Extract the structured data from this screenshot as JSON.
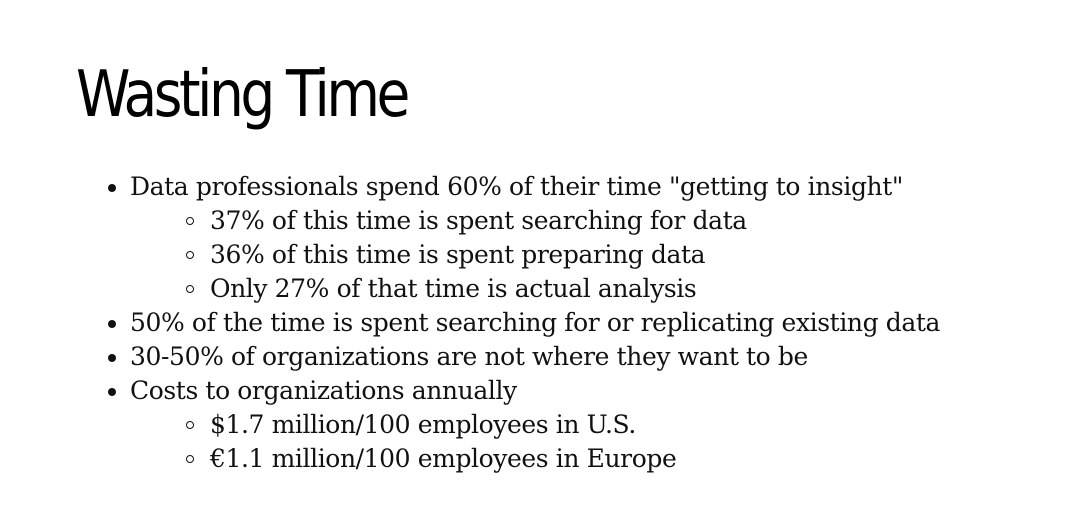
{
  "slide": {
    "title": "Wasting Time",
    "bullets": [
      {
        "text": "Data professionals spend 60% of their time \"getting to insight\"",
        "children": [
          "37% of this time is spent searching for data",
          "36% of this time is spent preparing data",
          "Only 27% of that time is actual analysis"
        ]
      },
      {
        "text": "50% of the time is spent searching for or replicating existing data",
        "children": []
      },
      {
        "text": "30-50% of organizations are not where they want to be",
        "children": []
      },
      {
        "text": "Costs to organizations annually",
        "children": [
          "$1.7 million/100 employees in U.S.",
          "€1.1 million/100 employees in Europe"
        ]
      }
    ]
  }
}
